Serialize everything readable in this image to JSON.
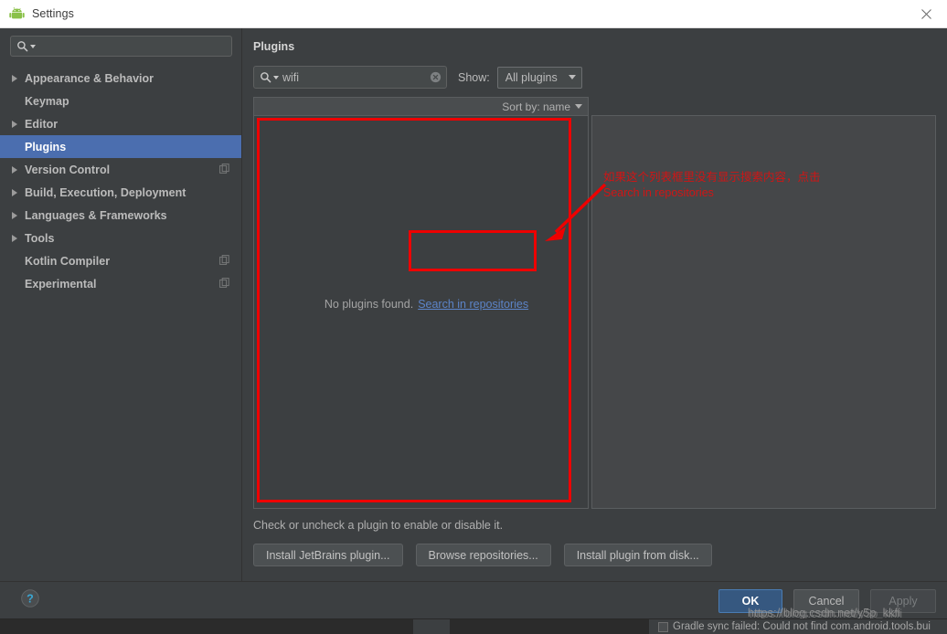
{
  "window": {
    "title": "Settings",
    "app_icon": "android-icon",
    "close_icon": "close-icon"
  },
  "sidebar": {
    "search": {
      "placeholder": "",
      "value": "",
      "icon": "search-icon"
    },
    "items": [
      {
        "label": "Appearance & Behavior",
        "expandable": true,
        "selected": false,
        "badge": false
      },
      {
        "label": "Keymap",
        "expandable": false,
        "selected": false,
        "badge": false
      },
      {
        "label": "Editor",
        "expandable": true,
        "selected": false,
        "badge": false
      },
      {
        "label": "Plugins",
        "expandable": false,
        "selected": true,
        "badge": false
      },
      {
        "label": "Version Control",
        "expandable": true,
        "selected": false,
        "badge": true
      },
      {
        "label": "Build, Execution, Deployment",
        "expandable": true,
        "selected": false,
        "badge": false
      },
      {
        "label": "Languages & Frameworks",
        "expandable": true,
        "selected": false,
        "badge": false
      },
      {
        "label": "Tools",
        "expandable": true,
        "selected": false,
        "badge": false
      },
      {
        "label": "Kotlin Compiler",
        "expandable": false,
        "selected": false,
        "badge": true
      },
      {
        "label": "Experimental",
        "expandable": false,
        "selected": false,
        "badge": true
      }
    ]
  },
  "plugins": {
    "page_title": "Plugins",
    "search": {
      "value": "wifi",
      "placeholder": "",
      "icon": "search-icon",
      "clear_icon": "clear-circle-icon"
    },
    "show_label": "Show:",
    "show_value": "All plugins",
    "sort_label": "Sort by: name",
    "empty_text": "No plugins found.",
    "empty_link": "Search in repositories",
    "hint": "Check or uncheck a plugin to enable or disable it.",
    "buttons": [
      {
        "label": "Install JetBrains plugin...",
        "mnemonic": "J"
      },
      {
        "label": "Browse repositories...",
        "mnemonic": "B"
      },
      {
        "label": "Install plugin from disk...",
        "mnemonic": "d"
      }
    ]
  },
  "footer": {
    "help_icon": "help-icon",
    "ok": "OK",
    "cancel": "Cancel",
    "apply": "Apply"
  },
  "annotations": {
    "note_line1": "如果这个列表框里没有显示搜索内容，点击",
    "note_line2": "Search in repositories",
    "color": "#ee0000"
  },
  "watermark": {
    "text": "https://blog.csdn.net/y5p_kkfi"
  },
  "statusbar": {
    "message": "Gradle sync failed: Could not find com.android.tools.bui"
  }
}
